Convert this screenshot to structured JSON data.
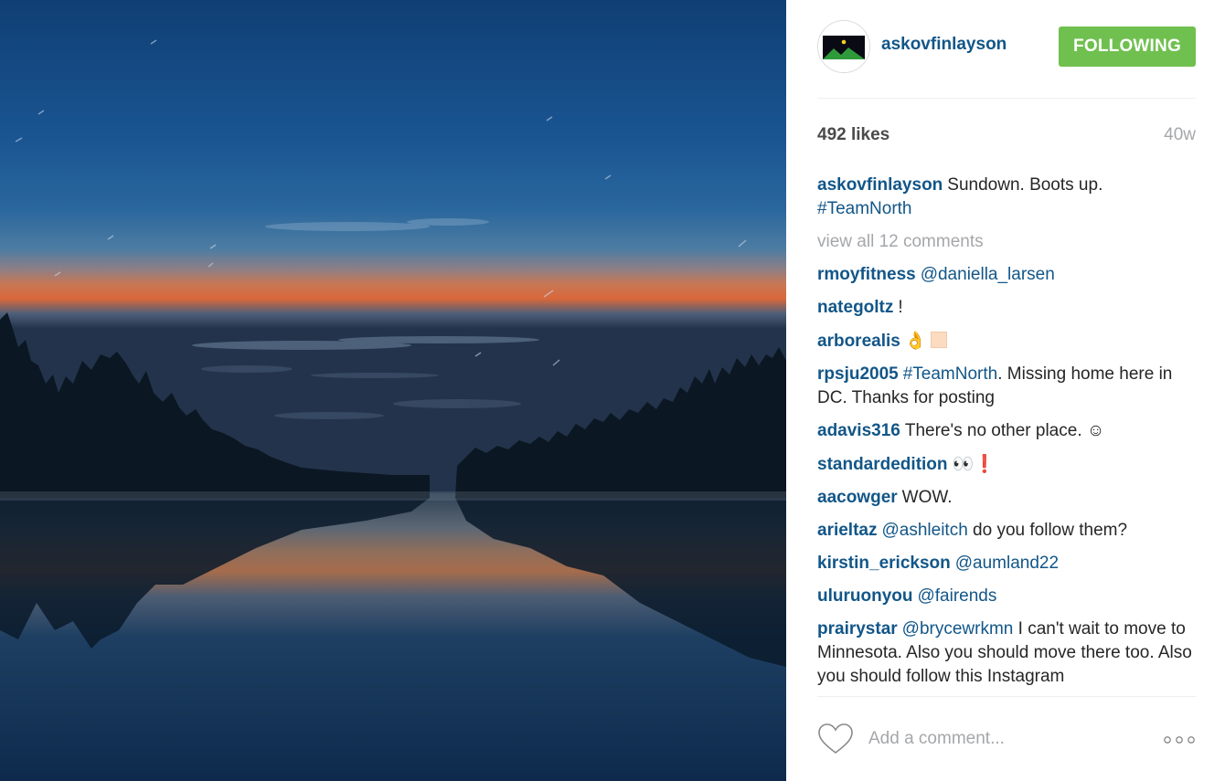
{
  "post": {
    "username": "askovfinlayson",
    "follow_label": "FOLLOWING",
    "likes": "492 likes",
    "age": "40w",
    "caption": {
      "user": "askovfinlayson",
      "text": "Sundown. Boots up.",
      "hashtag": "#TeamNorth"
    },
    "view_all": "view all 12 comments",
    "comments": [
      {
        "user": "rmoyfitness",
        "mention": "@daniella_larsen"
      },
      {
        "user": "nategoltz",
        "text": "!"
      },
      {
        "user": "arborealis",
        "emoji": "👌"
      },
      {
        "user": "rpsju2005",
        "hashtag": "#TeamNorth",
        "text": ". Missing home here in DC. Thanks for posting"
      },
      {
        "user": "adavis316",
        "text": "There's no other place. ☺"
      },
      {
        "user": "standardedition",
        "emoji": "👀",
        "extra": "❗"
      },
      {
        "user": "aacowger",
        "text": "WOW."
      },
      {
        "user": "arieltaz",
        "mention": "@ashleitch",
        "text": "do you follow them?"
      },
      {
        "user": "kirstin_erickson",
        "mention": "@aumland22"
      },
      {
        "user": "uluruonyou",
        "mention": "@fairends"
      },
      {
        "user": "prairystar",
        "mention": "@brycewrkmn",
        "text": "I can't wait to move to Minnesota. Also you should move there too. Also you should follow this Instagram"
      }
    ],
    "comment_placeholder": "Add a comment...",
    "colors": {
      "link": "#125688",
      "follow_button": "#70c050",
      "muted": "#a5a7aa"
    },
    "icons": {
      "like": "heart-outline-icon",
      "more": "more-options-icon"
    }
  }
}
